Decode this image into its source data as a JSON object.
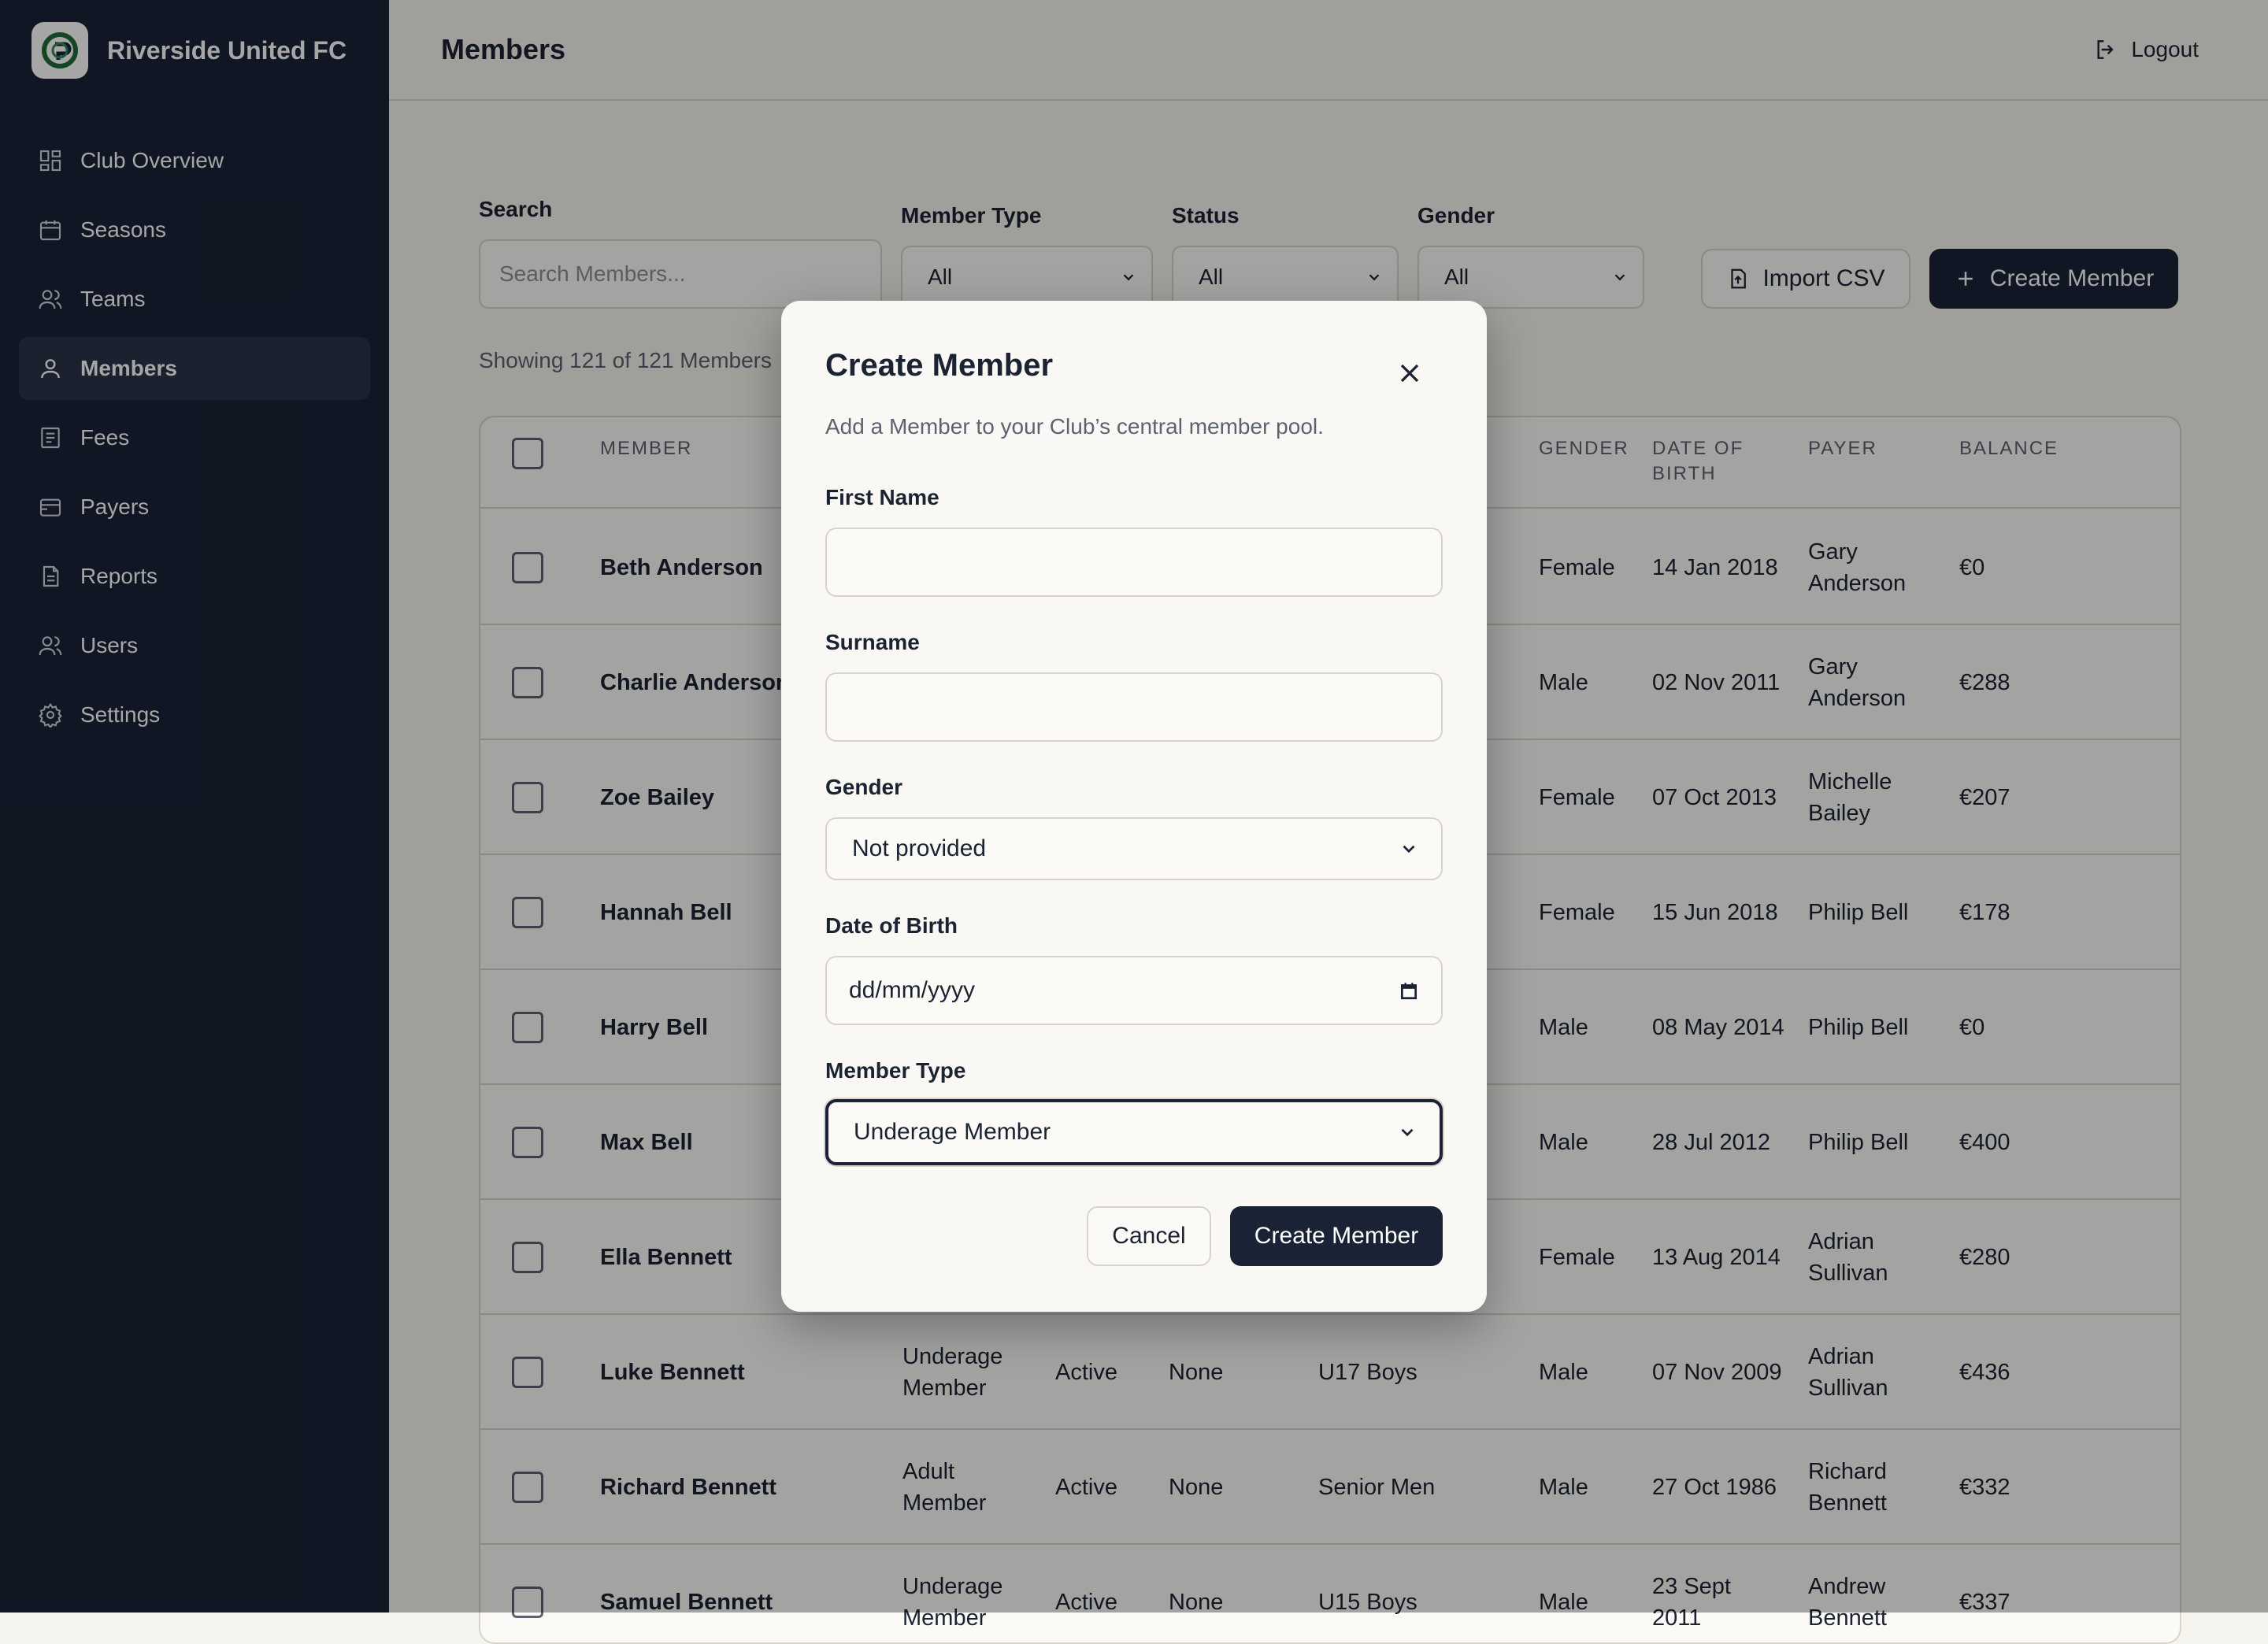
{
  "app": {
    "club_name": "Riverside United FC"
  },
  "sidebar": {
    "items": [
      {
        "label": "Club Overview",
        "icon": "dashboard-icon"
      },
      {
        "label": "Seasons",
        "icon": "calendar-icon"
      },
      {
        "label": "Teams",
        "icon": "users-icon"
      },
      {
        "label": "Members",
        "icon": "user-icon",
        "active": true
      },
      {
        "label": "Fees",
        "icon": "receipt-icon"
      },
      {
        "label": "Payers",
        "icon": "wallet-icon"
      },
      {
        "label": "Reports",
        "icon": "document-icon"
      },
      {
        "label": "Users",
        "icon": "users-icon"
      },
      {
        "label": "Settings",
        "icon": "gear-icon"
      }
    ]
  },
  "header": {
    "title": "Members",
    "logout_label": "Logout"
  },
  "filters": {
    "search_label": "Search",
    "search_placeholder": "Search Members...",
    "member_type_label": "Member Type",
    "member_type_value": "All",
    "status_label": "Status",
    "status_value": "All",
    "gender_label": "Gender",
    "gender_value": "All",
    "import_label": "Import CSV",
    "create_label": "Create Member"
  },
  "showing_text": "Showing 121 of 121 Members",
  "table": {
    "headers": {
      "member": "MEMBER",
      "gender": "GENDER",
      "dob": "DATE OF BIRTH",
      "payer": "PAYER",
      "balance": "BALANCE"
    },
    "rows": [
      {
        "member": "Beth Anderson",
        "type": "",
        "status": "",
        "discount": "",
        "team": "",
        "gender": "Female",
        "dob": "14 Jan 2018",
        "payer": "Gary Anderson",
        "balance": "€0"
      },
      {
        "member": "Charlie Anderson",
        "type": "",
        "status": "",
        "discount": "",
        "team": "",
        "gender": "Male",
        "dob": "02 Nov 2011",
        "payer": "Gary Anderson",
        "balance": "€288"
      },
      {
        "member": "Zoe Bailey",
        "type": "",
        "status": "",
        "discount": "",
        "team": "",
        "gender": "Female",
        "dob": "07 Oct 2013",
        "payer": "Michelle Bailey",
        "balance": "€207"
      },
      {
        "member": "Hannah Bell",
        "type": "",
        "status": "",
        "discount": "",
        "team": "",
        "gender": "Female",
        "dob": "15 Jun 2018",
        "payer": "Philip Bell",
        "balance": "€178"
      },
      {
        "member": "Harry Bell",
        "type": "",
        "status": "",
        "discount": "",
        "team": "",
        "gender": "Male",
        "dob": "08 May 2014",
        "payer": "Philip Bell",
        "balance": "€0"
      },
      {
        "member": "Max Bell",
        "type": "",
        "status": "",
        "discount": "",
        "team": "",
        "gender": "Male",
        "dob": "28 Jul 2012",
        "payer": "Philip Bell",
        "balance": "€400"
      },
      {
        "member": "Ella Bennett",
        "type": "",
        "status": "",
        "discount": "",
        "team": "",
        "gender": "Female",
        "dob": "13 Aug 2014",
        "payer": "Adrian Sullivan",
        "balance": "€280"
      },
      {
        "member": "Luke Bennett",
        "type": "Underage Member",
        "status": "Active",
        "discount": "None",
        "team": "U17 Boys",
        "gender": "Male",
        "dob": "07 Nov 2009",
        "payer": "Adrian Sullivan",
        "balance": "€436"
      },
      {
        "member": "Richard Bennett",
        "type": "Adult Member",
        "status": "Active",
        "discount": "None",
        "team": "Senior Men",
        "gender": "Male",
        "dob": "27 Oct 1986",
        "payer": "Richard Bennett",
        "balance": "€332"
      },
      {
        "member": "Samuel Bennett",
        "type": "Underage Member",
        "status": "Active",
        "discount": "None",
        "team": "U15 Boys",
        "gender": "Male",
        "dob": "23 Sept 2011",
        "payer": "Andrew Bennett",
        "balance": "€337"
      }
    ]
  },
  "modal": {
    "title": "Create Member",
    "description": "Add a Member to your Club’s central member pool.",
    "first_name_label": "First Name",
    "first_name_value": "",
    "surname_label": "Surname",
    "surname_value": "",
    "gender_label": "Gender",
    "gender_value": "Not provided",
    "dob_label": "Date of Birth",
    "dob_value": "dd/mm/yyyy",
    "member_type_label": "Member Type",
    "member_type_value": "Underage Member",
    "cancel_label": "Cancel",
    "create_label": "Create Member"
  }
}
